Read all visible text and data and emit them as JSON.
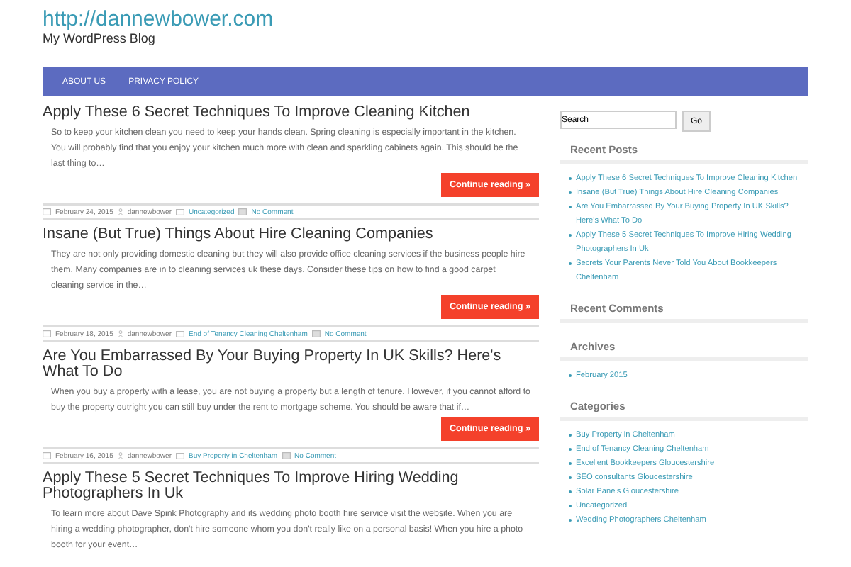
{
  "site": {
    "title": "http://dannewbower.com",
    "tagline": "My WordPress Blog"
  },
  "nav": [
    {
      "label": "ABOUT US"
    },
    {
      "label": "PRIVACY POLICY"
    }
  ],
  "posts": [
    {
      "title": "Apply These 6 Secret Techniques To Improve Cleaning Kitchen",
      "excerpt": "So to keep your kitchen clean you need to keep your hands clean. Spring cleaning is especially important in the kitchen. You will probably find that you enjoy your kitchen much more with clean and sparkling cabinets again. This should be the last thing to…",
      "more": "Continue reading »",
      "meta": {
        "date": "February 24, 2015",
        "author": "dannewbower",
        "category": "Uncategorized",
        "comments": "No Comment"
      }
    },
    {
      "title": "Insane (But True) Things About Hire Cleaning Companies",
      "excerpt": "They are not only providing domestic cleaning but they will also provide office cleaning services if the business people hire them. Many companies are in to cleaning services uk these days. Consider these tips on how to find a good carpet cleaning service in the…",
      "more": "Continue reading »",
      "meta": {
        "date": "February 18, 2015",
        "author": "dannewbower",
        "category": "End of Tenancy Cleaning Cheltenham",
        "comments": "No Comment"
      }
    },
    {
      "title": "Are You Embarrassed By Your Buying Property In UK Skills? Here's What To Do",
      "excerpt": "When you buy a property with a lease, you are not buying a property but a length of tenure. However, if you cannot afford to buy the property outright you can still buy under the rent to mortgage scheme. You should be aware that if…",
      "more": "Continue reading »",
      "meta": {
        "date": "February 16, 2015",
        "author": "dannewbower",
        "category": "Buy Property in Cheltenham",
        "comments": "No Comment"
      }
    },
    {
      "title": "Apply These 5 Secret Techniques To Improve Hiring Wedding Photographers In Uk",
      "excerpt": "To learn more about Dave Spink Photography and its wedding photo booth hire service visit the website. When you are hiring a wedding photographer, don't hire someone whom you don't really like on a personal basis! When you hire a photo booth for your event…"
    }
  ],
  "search": {
    "value": "Search",
    "button": "Go"
  },
  "widgets": [
    {
      "title": "Recent Posts",
      "items": [
        "Apply These 6 Secret Techniques To Improve Cleaning Kitchen",
        "Insane (But True) Things About Hire Cleaning Companies",
        "Are You Embarrassed By Your Buying Property In UK Skills? Here's What To Do",
        "Apply These 5 Secret Techniques To Improve Hiring Wedding Photographers In Uk",
        "Secrets Your Parents Never Told You About Bookkeepers Cheltenham"
      ]
    },
    {
      "title": "Recent Comments"
    },
    {
      "title": "Archives",
      "items": [
        "February 2015"
      ]
    },
    {
      "title": "Categories",
      "items": [
        "Buy Property in Cheltenham",
        "End of Tenancy Cleaning Cheltenham",
        "Excellent Bookkeepers Gloucestershire",
        "SEO consultants Gloucestershire",
        "Solar Panels Gloucestershire",
        "Uncategorized",
        "Wedding Photographers Cheltenham"
      ]
    }
  ]
}
